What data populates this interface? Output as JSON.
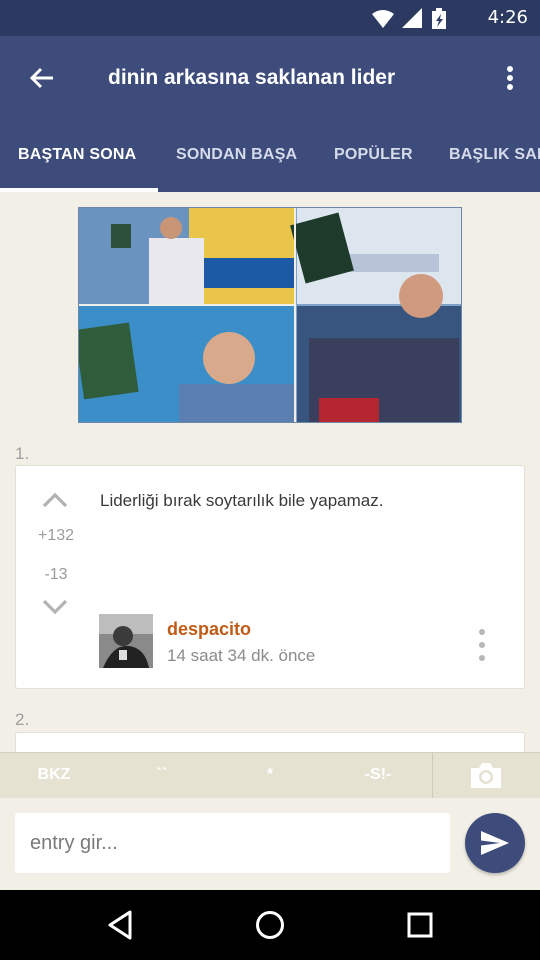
{
  "status_bar": {
    "time": "4:26",
    "icons": [
      "wifi-icon",
      "signal-icon",
      "battery-charging-icon"
    ],
    "background": "#2c3a61"
  },
  "app_bar": {
    "title": "dinin arkasına saklanan lider",
    "back_icon": "arrow-back-icon",
    "menu_icon": "more-vert-icon",
    "background": "#3d4c7b"
  },
  "tabs": [
    {
      "label": "BAŞTAN SONA",
      "active": true
    },
    {
      "label": "SONDAN BAŞA",
      "active": false
    },
    {
      "label": "POPÜLER",
      "active": false
    },
    {
      "label": "BAŞLIK SAHİBİ",
      "active": false
    }
  ],
  "entries": [
    {
      "index": "1.",
      "text": "Liderliği bırak soytarılık bile yapamaz.",
      "upvotes": "+132",
      "downvotes": "-13",
      "author": "despacito",
      "time": "14 saat 34 dk. önce"
    },
    {
      "index": "2."
    }
  ],
  "format_bar": {
    "buttons": [
      "BKZ",
      "``",
      "*",
      "-S!-"
    ],
    "camera_icon": "camera-icon"
  },
  "composer": {
    "placeholder": "entry gir...",
    "send_icon": "send-icon"
  },
  "nav_bar": {
    "icons": [
      "back-triangle-icon",
      "home-circle-icon",
      "recents-square-icon"
    ]
  },
  "colors": {
    "accent": "#3d4c7b",
    "author": "#c05c16",
    "page_background": "#f2efe6"
  }
}
